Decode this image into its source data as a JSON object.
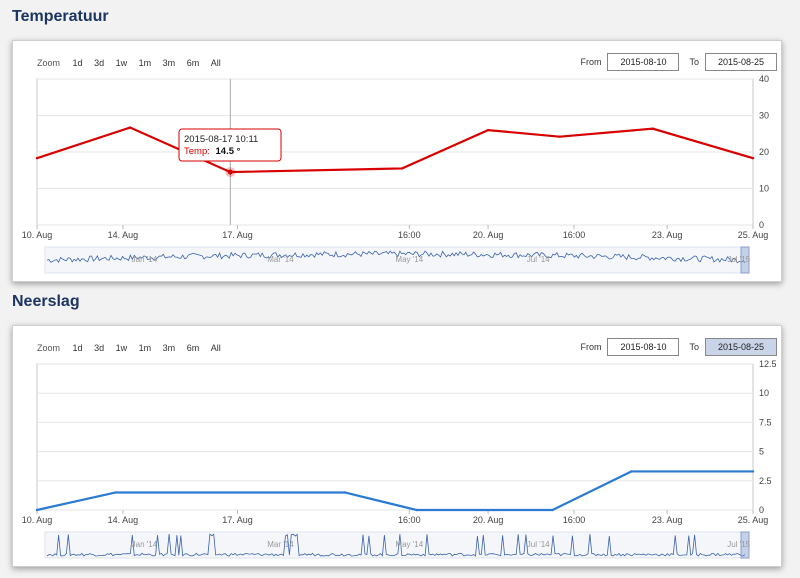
{
  "panels": [
    {
      "title": "Temperatuur",
      "zoom_label": "Zoom",
      "zoom_buttons": [
        "1d",
        "3d",
        "1w",
        "1m",
        "3m",
        "6m",
        "All"
      ],
      "from_label": "From",
      "from_value": "2015-08-10",
      "to_label": "To",
      "to_value": "2015-08-25",
      "tooltip": {
        "date": "2015-08-17 10:11",
        "series_label": "Temp:",
        "value": "14.5 °"
      },
      "navigator_labels": [
        "Jan '14",
        "Mar '14",
        "May '14",
        "Jul '14",
        "Jul '15"
      ]
    },
    {
      "title": "Neerslag",
      "zoom_label": "Zoom",
      "zoom_buttons": [
        "1d",
        "3d",
        "1w",
        "1m",
        "3m",
        "6m",
        "All"
      ],
      "from_label": "From",
      "from_value": "2015-08-10",
      "to_label": "To",
      "to_value": "2015-08-25",
      "navigator_labels": [
        "Jan '14",
        "Mar '14",
        "May '14",
        "Jul '14",
        "Jul '15"
      ]
    }
  ],
  "chart_data": [
    {
      "type": "line",
      "color": "#d90000",
      "x_ticks": [
        "10. Aug",
        "14. Aug",
        "17. Aug",
        "16:00",
        "20. Aug",
        "16:00",
        "23. Aug",
        "25. Aug"
      ],
      "y_ticks": [
        "0",
        "10",
        "20",
        "30",
        "40"
      ],
      "ylim": [
        0,
        40
      ],
      "x": [
        0,
        1.3,
        2.7,
        5.1,
        6.3,
        7.3,
        8.6,
        10
      ],
      "values": [
        18.3,
        26.7,
        14.5,
        15.5,
        26.0,
        24.2,
        26.4,
        18.3
      ]
    },
    {
      "type": "line",
      "color": "#2a7bd1",
      "x_ticks": [
        "10. Aug",
        "14. Aug",
        "17. Aug",
        "16:00",
        "20. Aug",
        "16:00",
        "23. Aug",
        "25. Aug"
      ],
      "y_ticks": [
        "0",
        "2.5",
        "5",
        "7.5",
        "10",
        "12.5"
      ],
      "ylim": [
        0,
        12.5
      ],
      "x": [
        0,
        1.1,
        4.3,
        5.3,
        7.2,
        8.3,
        10
      ],
      "values": [
        0,
        1.5,
        1.5,
        0,
        0,
        3.3,
        3.3
      ]
    }
  ]
}
